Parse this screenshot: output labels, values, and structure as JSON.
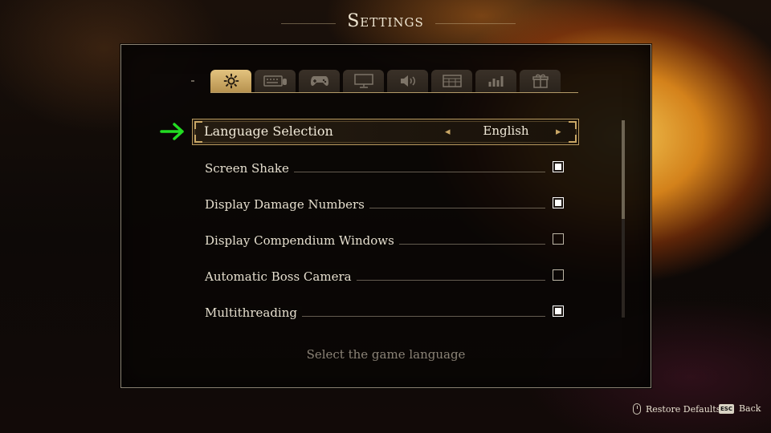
{
  "header": {
    "title": "Settings"
  },
  "tabs": [
    {
      "icon": "gear-icon",
      "active": true
    },
    {
      "icon": "keyboard-icon",
      "active": false
    },
    {
      "icon": "gamepad-icon",
      "active": false
    },
    {
      "icon": "monitor-icon",
      "active": false
    },
    {
      "icon": "speaker-icon",
      "active": false
    },
    {
      "icon": "grid-icon",
      "active": false
    },
    {
      "icon": "stats-icon",
      "active": false
    },
    {
      "icon": "gift-icon",
      "active": false
    }
  ],
  "selected": {
    "label": "Language Selection",
    "value": "English",
    "arrow_left": "◂",
    "arrow_right": "▸"
  },
  "settings": [
    {
      "label": "Screen Shake",
      "checked": true
    },
    {
      "label": "Display Damage Numbers",
      "checked": true
    },
    {
      "label": "Display Compendium Windows",
      "checked": false
    },
    {
      "label": "Automatic Boss Camera",
      "checked": false
    },
    {
      "label": "Multithreading",
      "checked": true
    }
  ],
  "description": "Select the game language",
  "footer": {
    "restore_label": "Restore Defaults",
    "esc_key": "ESC",
    "back_label": "Back"
  },
  "colors": {
    "accent_gold": "#c9a766",
    "pointer_green": "#22dd22"
  },
  "scroll": {
    "visible_fraction": 0.5
  }
}
